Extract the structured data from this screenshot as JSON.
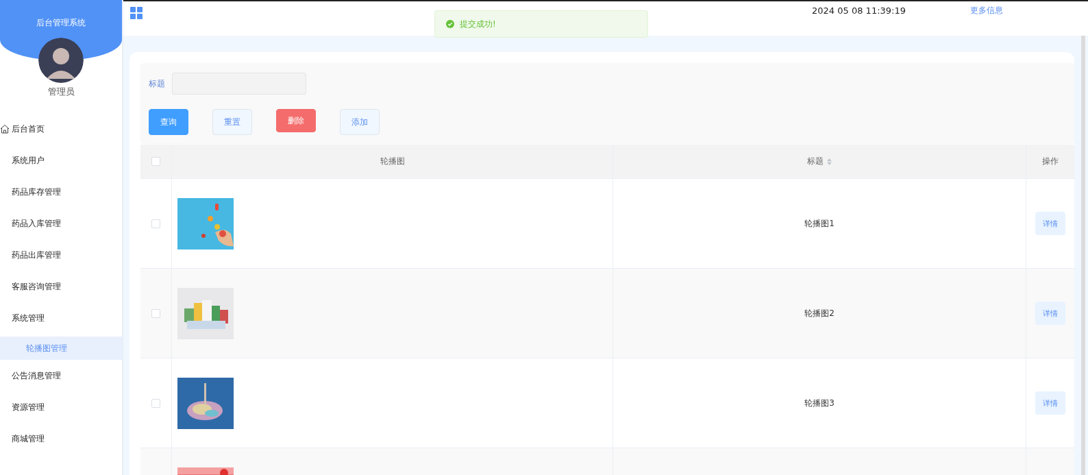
{
  "sidebar": {
    "title": "后台管理系统",
    "user": "管理员",
    "items": [
      {
        "label": "后台首页",
        "selected": false
      },
      {
        "label": "系统用户",
        "selected": false
      },
      {
        "label": "药品库存管理",
        "selected": false
      },
      {
        "label": "药品入库管理",
        "selected": false
      },
      {
        "label": "药品出库管理",
        "selected": false
      },
      {
        "label": "客服咨询管理",
        "selected": false
      },
      {
        "label": "系统管理",
        "selected": false,
        "children": [
          {
            "label": "轮播图管理",
            "selected": true
          }
        ]
      },
      {
        "label": "公告消息管理",
        "selected": false
      },
      {
        "label": "资源管理",
        "selected": false
      },
      {
        "label": "商城管理",
        "selected": false
      }
    ]
  },
  "header": {
    "datetime": "2024 05 08 11:39:19",
    "more_link": "更多信息"
  },
  "toast": {
    "kind": "success",
    "message": "提交成功!"
  },
  "search": {
    "label": "标题",
    "buttons": [
      {
        "label": "查询",
        "kind": "primary"
      },
      {
        "label": "重置",
        "kind": "plain"
      },
      {
        "label": "删除",
        "kind": "danger"
      },
      {
        "label": "添加",
        "kind": "plain"
      }
    ]
  },
  "table": {
    "select_all_checked": false,
    "columns": [
      {
        "label": "轮播图"
      },
      {
        "label": "标题",
        "sortable": true
      },
      {
        "label": "操作"
      }
    ],
    "rows": [
      {
        "kind": "picture",
        "checked": false,
        "title": "轮播图1",
        "action": "详情"
      },
      {
        "kind": "picture",
        "checked": false,
        "title": "轮播图2",
        "action": "详情"
      },
      {
        "kind": "picture",
        "checked": false,
        "title": "轮播图3",
        "action": "详情"
      },
      {
        "kind": "picture"
      }
    ]
  }
}
